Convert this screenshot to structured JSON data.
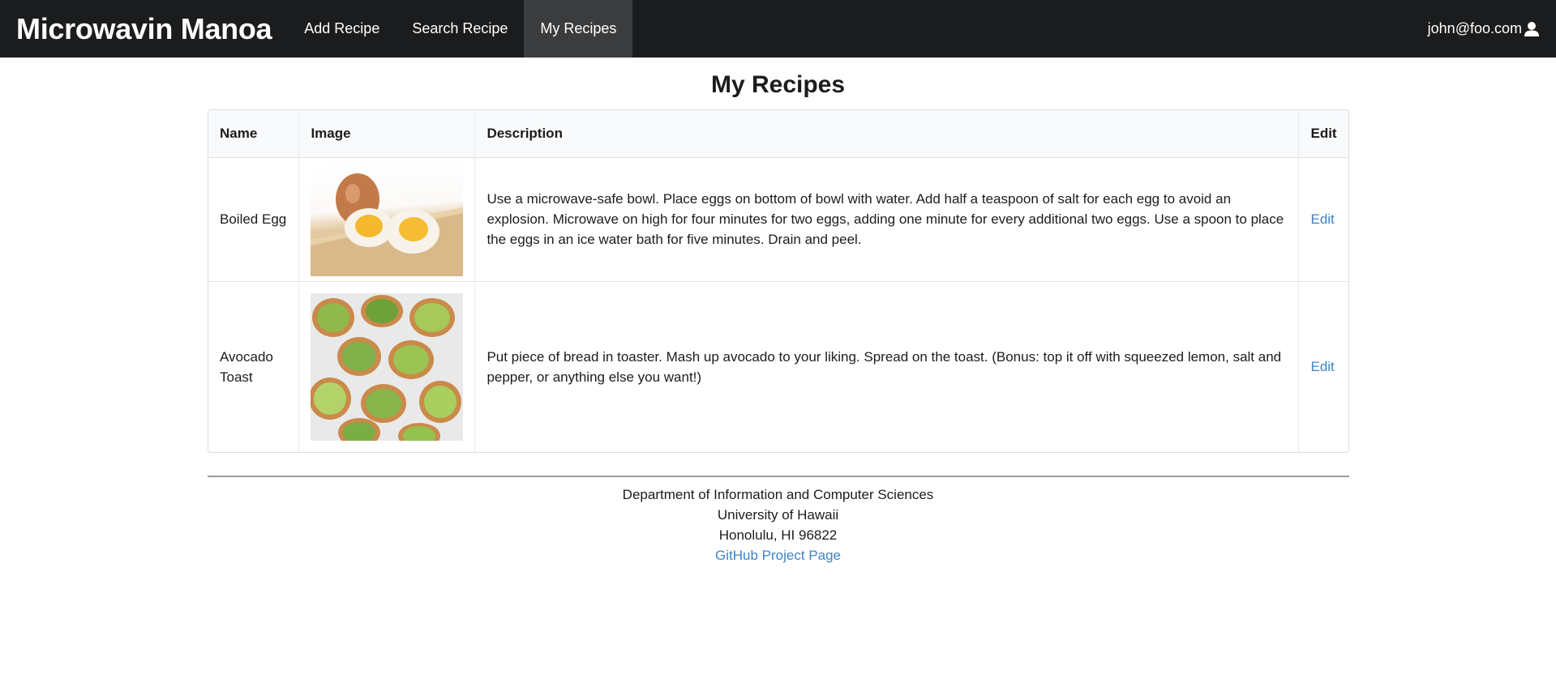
{
  "navbar": {
    "brand": "Microwavin Manoa",
    "items": [
      {
        "label": "Add Recipe",
        "active": false
      },
      {
        "label": "Search Recipe",
        "active": false
      },
      {
        "label": "My Recipes",
        "active": true
      }
    ],
    "user_email": "john@foo.com",
    "user_icon": "user-icon"
  },
  "page": {
    "title": "My Recipes"
  },
  "table": {
    "headers": [
      "Name",
      "Image",
      "Description",
      "Edit"
    ],
    "rows": [
      {
        "name": "Boiled Egg",
        "image": "boiled-egg-image",
        "description": "Use a microwave-safe bowl. Place eggs on bottom of bowl with water. Add half a teaspoon of salt for each egg to avoid an explosion. Microwave on high for four minutes for two eggs, adding one minute for every additional two eggs. Use a spoon to place the eggs in an ice water bath for five minutes. Drain and peel.",
        "edit": "Edit"
      },
      {
        "name": "Avocado Toast",
        "image": "avocado-toast-image",
        "description": "Put piece of bread in toaster. Mash up avocado to your liking. Spread on the toast. (Bonus: top it off with squeezed lemon, salt and pepper, or anything else you want!)",
        "edit": "Edit"
      }
    ]
  },
  "footer": {
    "line1": "Department of Information and Computer Sciences",
    "line2": "University of Hawaii",
    "line3": "Honolulu, HI 96822",
    "link": "GitHub Project Page"
  },
  "colors": {
    "navbar_bg": "#1b1c1d",
    "active_item_bg": "#3b3c3d",
    "link": "#4183c4"
  }
}
